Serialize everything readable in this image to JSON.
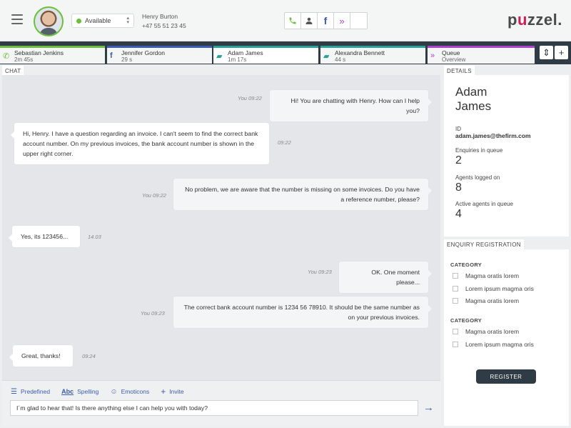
{
  "header": {
    "status": "Available",
    "user_name": "Henry Burton",
    "user_phone": "+47 55 51 23 45",
    "logo_text_a": "p",
    "logo_text_u": "u",
    "logo_text_b": "zzel."
  },
  "tabs": [
    {
      "name": "Sebastian Jenkins",
      "time": "2m 45s",
      "icon": "phone-icon",
      "color": "#6bbf3b"
    },
    {
      "name": "Jennifer Gordon",
      "time": "29 s",
      "icon": "facebook-icon",
      "color": "#3b5bb5"
    },
    {
      "name": "Adam James",
      "time": "1m 17s",
      "icon": "chat-icon",
      "color": "#2aa198"
    },
    {
      "name": "Alexandra Bennett",
      "time": "44 s",
      "icon": "chat-icon",
      "color": "#2aa198"
    },
    {
      "name": "Queue",
      "time": "Overview",
      "icon": "queue-icon",
      "color": "#b03fd0"
    }
  ],
  "chat": {
    "label": "CHAT",
    "messages": [
      {
        "from": "agent",
        "meta": "You 09:22",
        "text": "Hi! You are chatting with Henry. How can I help you?"
      },
      {
        "from": "customer",
        "meta": "09:22",
        "text": "Hi, Henry. I have a question regarding an invoice. I can't seem to find the correct bank account number. On my previous invoices, the bank account number is shown in the upper right corner."
      },
      {
        "from": "agent",
        "meta": "You 09:22",
        "text": "No problem, we are aware that the number is missing on some invoices. Do you have a reference number, please?"
      },
      {
        "from": "customer",
        "meta": "14.03",
        "text": "Yes, its 123456..."
      },
      {
        "from": "agent",
        "meta": "You 09:23",
        "text": "OK. One moment please..."
      },
      {
        "from": "agent",
        "meta": "You 09:23",
        "text": "The correct bank account number is 1234 56 78910. It should be the same number as on your previous invoices."
      },
      {
        "from": "customer",
        "meta": "09:24",
        "text": "Great, thanks!"
      }
    ],
    "tools": [
      "Predefined",
      "Spelling",
      "Emoticons",
      "Invite"
    ],
    "input_value": "I´m glad to hear that! Is there anything else I can help you with today?"
  },
  "details": {
    "label": "DETAILS",
    "first_name": "Adam",
    "last_name": "James",
    "id_label": "ID",
    "email": "adam.james@thefirm.com",
    "enquiries_label": "Enquiries in queue",
    "enquiries_value": "2",
    "agents_label": "Agents logged on",
    "agents_value": "8",
    "active_label": "Active agents in queue",
    "active_value": "4"
  },
  "registration": {
    "label": "ENQUIRY REGISTRATION",
    "category1": "CATEGORY",
    "options1": [
      "Magma oratis lorem",
      "Lorem ipsum magma oris",
      "Magma oratis lorem"
    ],
    "category2": "CATEGORY",
    "options2": [
      "Magma oratis lorem",
      "Lorem ipsum magma oris"
    ],
    "button": "REGISTER"
  }
}
